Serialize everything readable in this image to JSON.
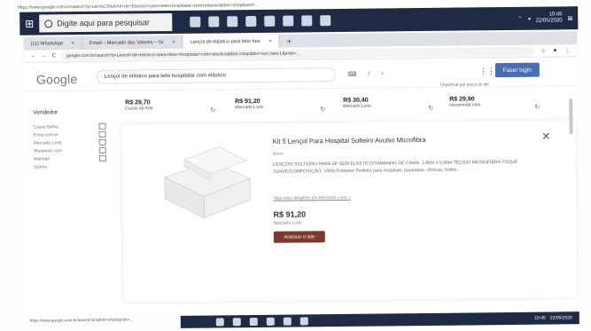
{
  "outer_url": "https://www.google.com.br/search?q=Len%C3%A7ol+de+Elastico+para+leito+hospitalar+com+elastico&tbm=shop&ved=...",
  "taskbar": {
    "search_placeholder": "Digite aqui para pesquisar",
    "time": "10:45",
    "date": "22/05/2020"
  },
  "tabs": [
    {
      "label": "(11) WhatsApp",
      "close": "×"
    },
    {
      "label": "Email – Mercado das Valores – Gr",
      "close": "×"
    },
    {
      "label": "Lençol de elástico para leito hos",
      "close": "×"
    }
  ],
  "new_tab": "+",
  "address": {
    "url": "google.com.br/search?q=Lencol+de+elastico+para+leito+hospitalar+com+elastico&tbm=shop&tbs=vw:l,new:1&prds=...",
    "back": "←",
    "forward": "→",
    "reload": "C"
  },
  "google": {
    "logo": "Google",
    "query": "Lençol de elástico para leito hospitalar com elástico",
    "apps": "⋮⋮⋮",
    "signin": "Fazer login",
    "subtitle": "Classificar por preço de até"
  },
  "sidebar": {
    "title": "Vendedor",
    "vendors": [
      "Casas Bahia",
      "Extra.com.br",
      "Mercado Livre",
      "Shoptime.com",
      "Walmart",
      "Outros"
    ]
  },
  "offers": [
    {
      "price": "R$ 29,70",
      "store": "Casas da Arte"
    },
    {
      "price": "R$ 91,20",
      "store": "Mercado Livre"
    },
    {
      "price": "R$ 30,40",
      "store": "Mercado Livre"
    },
    {
      "price": "R$ 29,90",
      "store": "Novamoda.com"
    }
  ],
  "panel": {
    "title": "Kit 5 Lençol Para Hospital Solteiro Avulso Microfibra",
    "store_label": "Novo",
    "description": "LENÇÓIS SOLTEIRO PARA SP SEM ELÁSTICO/TAMANHO DE CAMA: 1,90m x 0,90m TECIDO MICROFIBRA TOQUE SUAVE/COMPOSIÇÃO: 100% Poliéster Perfeito para hospitais, pousadas, clínicas, hotéis.",
    "link": "Veja mais detalhes em Mercado Livre »",
    "price": "R$ 91,20",
    "store": "Mercado Livre",
    "visit": "Acessar o site",
    "close": "×"
  },
  "bottom": {
    "url": "https://www.google.com.br/search?q=&tbm=shop&prds=...",
    "time": "10:45",
    "date": "22/05/2020"
  }
}
